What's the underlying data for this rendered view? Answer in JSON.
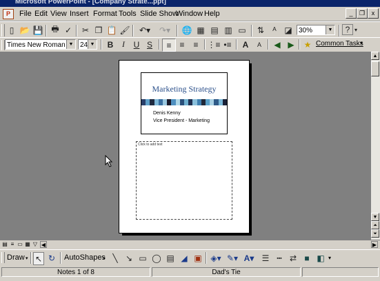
{
  "window": {
    "title": "Microsoft PowerPoint - [Company Strate...ppt]"
  },
  "menu": {
    "items": [
      "File",
      "Edit",
      "View",
      "Insert",
      "Format",
      "Tools",
      "Slide Show",
      "Window",
      "Help"
    ],
    "window_buttons": [
      "_",
      "❐",
      "x"
    ]
  },
  "standard_toolbar": {
    "zoom": "30%",
    "help_icon": "?"
  },
  "formatting_toolbar": {
    "font_name": "Times New Roman",
    "font_size": "24",
    "bold": "B",
    "italic": "I",
    "underline": "U",
    "shadow": "S",
    "common_tasks": "Common Tasks"
  },
  "slide": {
    "title": "Marketing Strategy",
    "presenter": "Denis Kenny",
    "presenter_role": "Vice President - Marketing",
    "stripe_colors": [
      "#2a3f6a",
      "#5fa0c8",
      "#1f2a40",
      "#7fb8d8",
      "#3a6fa0",
      "#9ac8e0",
      "#1a1a2a",
      "#4f90c0",
      "#b0d8e8",
      "#2a4f7a",
      "#6fb0d0",
      "#1f2f50",
      "#8ac0dc",
      "#3f7fb0",
      "#202838",
      "#5aa0c8",
      "#a8d0e4",
      "#2f5a88",
      "#7ab8d8",
      "#1a2238"
    ]
  },
  "notes_page": {
    "placeholder_label": "Click to add text"
  },
  "draw_toolbar": {
    "draw_label": "Draw",
    "autoshapes_label": "AutoShapes"
  },
  "status_bar": {
    "page": "Notes 1 of 8",
    "design": "Dad's Tie"
  }
}
